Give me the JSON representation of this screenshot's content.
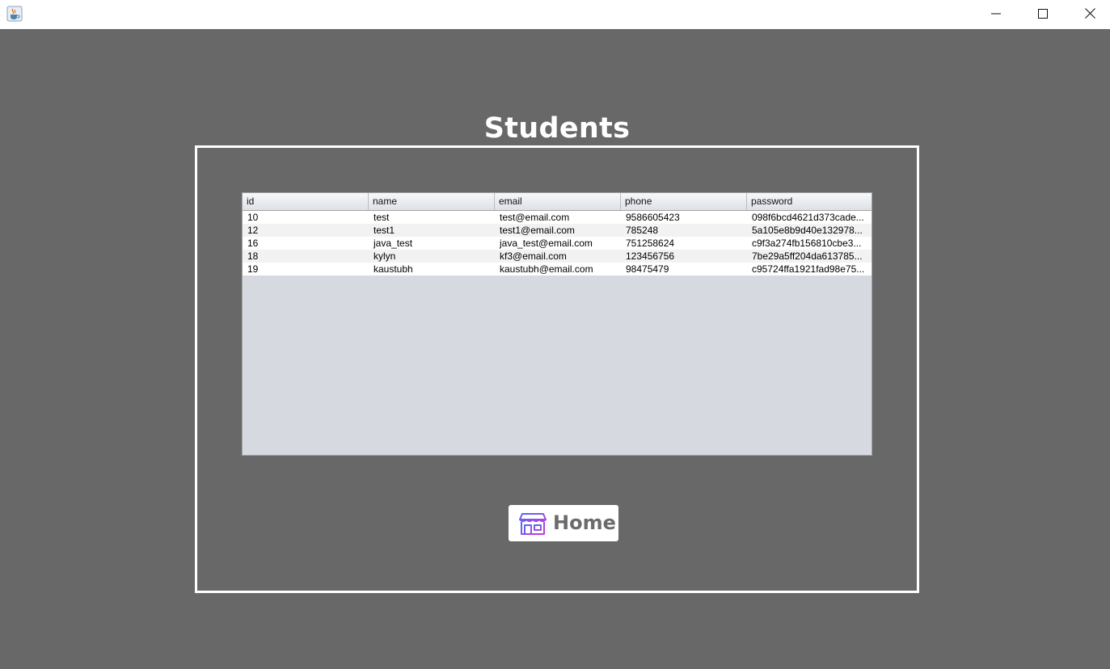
{
  "window": {
    "app_icon": "java-coffee-icon",
    "controls": [
      "minimize-icon",
      "maximize-icon",
      "close-icon"
    ]
  },
  "page": {
    "title": "Students",
    "background": "#686868"
  },
  "table": {
    "columns": [
      "id",
      "name",
      "email",
      "phone",
      "password"
    ],
    "rows": [
      [
        "10",
        "test",
        "test@email.com",
        "9586605423",
        "098f6bcd4621d373cade..."
      ],
      [
        "12",
        "test1",
        "test1@email.com",
        "785248",
        "5a105e8b9d40e132978..."
      ],
      [
        "16",
        "java_test",
        "java_test@email.com",
        "751258624",
        "c9f3a274fb156810cbe3..."
      ],
      [
        "18",
        "kylyn",
        "kf3@email.com",
        "123456756",
        "7be29a5ff204da613785..."
      ],
      [
        "19",
        "kaustubh",
        "kaustubh@email.com",
        "98475479",
        "c95724ffa1921fad98e75..."
      ]
    ]
  },
  "home_button": {
    "label": "Home",
    "icon": "storefront-icon",
    "icon_colors": [
      "#4b6cf7",
      "#c33bd8"
    ]
  }
}
